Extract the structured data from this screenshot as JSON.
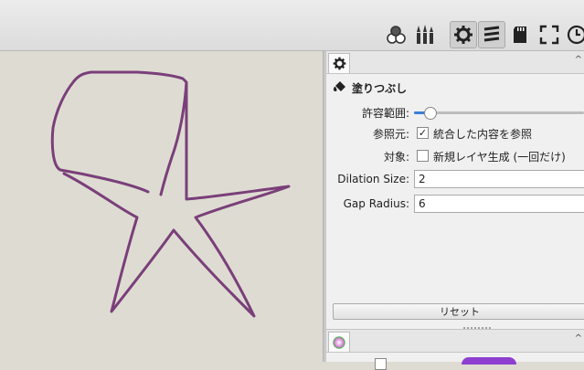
{
  "toolbar": {
    "icons": [
      "layers-icon",
      "brushes-icon",
      "tool-settings-icon",
      "tool-list-icon",
      "sd-card-icon",
      "fullscreen-icon",
      "clock-icon"
    ]
  },
  "tool_panel": {
    "tab_icon": "gear-icon",
    "tool_icon": "paint-bucket-icon",
    "tool_name": "塗りつぶし",
    "tolerance_label": "許容範囲:",
    "tolerance_fraction": 0.09,
    "reference_label": "参照元:",
    "reference_checked": true,
    "reference_option": "統合した内容を参照",
    "target_label": "対象:",
    "target_checked": false,
    "target_option": "新規レイヤ生成 (一回だけ)",
    "dilation_label": "Dilation Size:",
    "dilation_value": "2",
    "gap_label": "Gap Radius:",
    "gap_value": "6",
    "reset_label": "リセット"
  },
  "color_panel": {
    "tab_icon": "color-wheel-icon"
  },
  "colors": {
    "stroke": "#7a3f7a",
    "canvas_bg": "#dedcd2",
    "accent": "#3b7dd8"
  }
}
